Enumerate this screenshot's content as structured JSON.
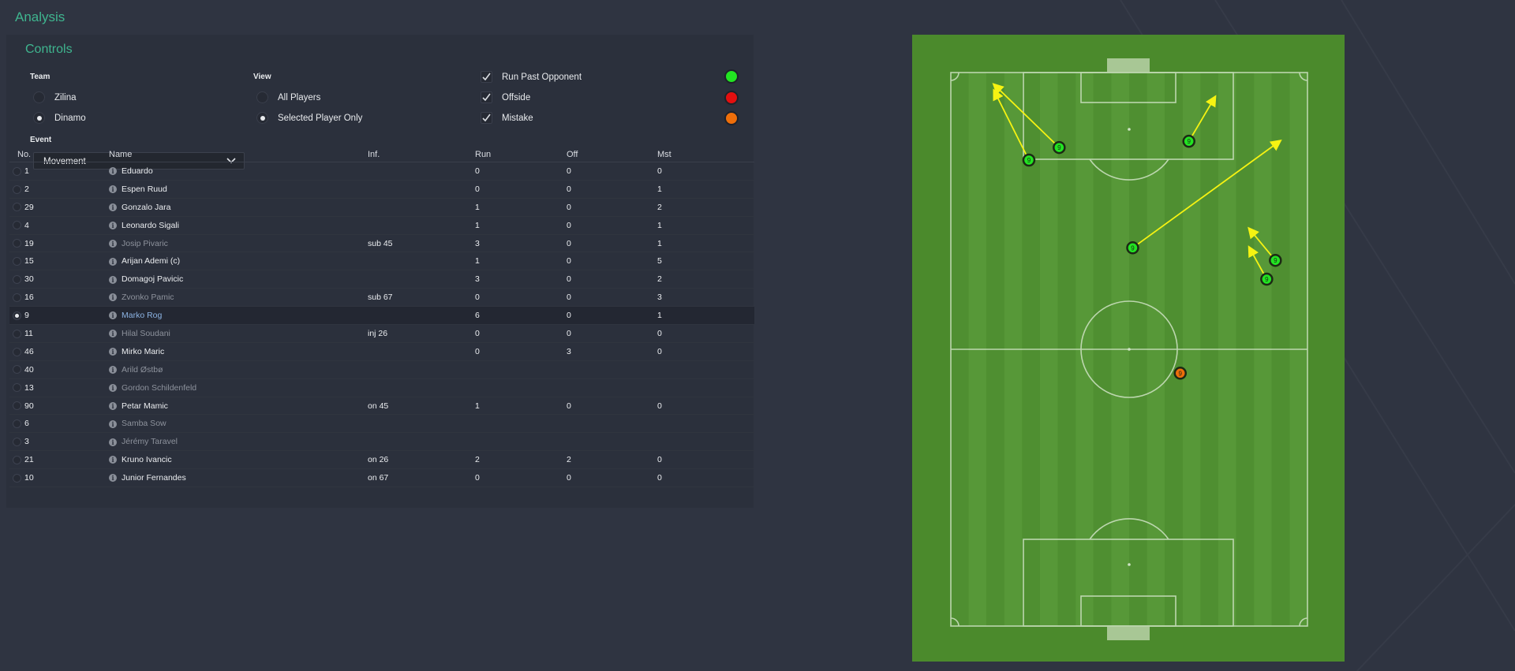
{
  "header": {
    "title": "Analysis"
  },
  "controls": {
    "title": "Controls",
    "team": {
      "label": "Team",
      "options": [
        "Zilina",
        "Dinamo"
      ],
      "selected": "Dinamo"
    },
    "view": {
      "label": "View",
      "options": [
        "All Players",
        "Selected Player Only"
      ],
      "selected": "Selected Player Only"
    },
    "filters": [
      {
        "label": "Run Past Opponent",
        "checked": true,
        "color": "#22e422"
      },
      {
        "label": "Offside",
        "checked": true,
        "color": "#e40f0f"
      },
      {
        "label": "Mistake",
        "checked": true,
        "color": "#ef6e0a"
      }
    ],
    "event": {
      "label": "Event",
      "value": "Movement"
    }
  },
  "table": {
    "headers": {
      "no": "No.",
      "name": "Name",
      "inf": "Inf.",
      "run": "Run",
      "off": "Off",
      "mst": "Mst"
    },
    "rows": [
      {
        "no": "1",
        "name": "Eduardo",
        "inf": "",
        "run": "0",
        "off": "0",
        "mst": "0",
        "dim": false,
        "selected": false
      },
      {
        "no": "2",
        "name": "Espen Ruud",
        "inf": "",
        "run": "0",
        "off": "0",
        "mst": "1",
        "dim": false,
        "selected": false
      },
      {
        "no": "29",
        "name": "Gonzalo Jara",
        "inf": "",
        "run": "1",
        "off": "0",
        "mst": "2",
        "dim": false,
        "selected": false
      },
      {
        "no": "4",
        "name": "Leonardo Sigali",
        "inf": "",
        "run": "1",
        "off": "0",
        "mst": "1",
        "dim": false,
        "selected": false
      },
      {
        "no": "19",
        "name": "Josip Pivaric",
        "inf": "sub 45",
        "run": "3",
        "off": "0",
        "mst": "1",
        "dim": true,
        "selected": false
      },
      {
        "no": "15",
        "name": "Arijan Ademi (c)",
        "inf": "",
        "run": "1",
        "off": "0",
        "mst": "5",
        "dim": false,
        "selected": false
      },
      {
        "no": "30",
        "name": "Domagoj Pavicic",
        "inf": "",
        "run": "3",
        "off": "0",
        "mst": "2",
        "dim": false,
        "selected": false
      },
      {
        "no": "16",
        "name": "Zvonko Pamic",
        "inf": "sub 67",
        "run": "0",
        "off": "0",
        "mst": "3",
        "dim": true,
        "selected": false
      },
      {
        "no": "9",
        "name": "Marko Rog",
        "inf": "",
        "run": "6",
        "off": "0",
        "mst": "1",
        "dim": false,
        "selected": true
      },
      {
        "no": "11",
        "name": "Hilal Soudani",
        "inf": "inj 26",
        "run": "0",
        "off": "0",
        "mst": "0",
        "dim": true,
        "selected": false
      },
      {
        "no": "46",
        "name": "Mirko Maric",
        "inf": "",
        "run": "0",
        "off": "3",
        "mst": "0",
        "dim": false,
        "selected": false
      },
      {
        "no": "40",
        "name": "Arild Østbø",
        "inf": "",
        "run": "",
        "off": "",
        "mst": "",
        "dim": true,
        "selected": false
      },
      {
        "no": "13",
        "name": "Gordon Schildenfeld",
        "inf": "",
        "run": "",
        "off": "",
        "mst": "",
        "dim": true,
        "selected": false
      },
      {
        "no": "90",
        "name": "Petar Mamic",
        "inf": "on 45",
        "run": "1",
        "off": "0",
        "mst": "0",
        "dim": false,
        "selected": false
      },
      {
        "no": "6",
        "name": "Samba Sow",
        "inf": "",
        "run": "",
        "off": "",
        "mst": "",
        "dim": true,
        "selected": false
      },
      {
        "no": "3",
        "name": "Jérémy Taravel",
        "inf": "",
        "run": "",
        "off": "",
        "mst": "",
        "dim": true,
        "selected": false
      },
      {
        "no": "21",
        "name": "Kruno Ivancic",
        "inf": "on 26",
        "run": "2",
        "off": "2",
        "mst": "0",
        "dim": false,
        "selected": false
      },
      {
        "no": "10",
        "name": "Junior Fernandes",
        "inf": "on 67",
        "run": "0",
        "off": "0",
        "mst": "0",
        "dim": false,
        "selected": false
      }
    ]
  },
  "pitch": {
    "events": [
      {
        "type": "run",
        "shirt": "9",
        "from": [
          0.27,
          0.2
        ],
        "to": [
          0.19,
          0.09
        ]
      },
      {
        "type": "run",
        "shirt": "9",
        "from": [
          0.34,
          0.18
        ],
        "to": [
          0.19,
          0.08
        ]
      },
      {
        "type": "run",
        "shirt": "9",
        "from": [
          0.64,
          0.17
        ],
        "to": [
          0.7,
          0.1
        ]
      },
      {
        "type": "run",
        "shirt": "9",
        "from": [
          0.51,
          0.34
        ],
        "to": [
          0.85,
          0.17
        ]
      },
      {
        "type": "run",
        "shirt": "9",
        "from": [
          0.84,
          0.36
        ],
        "to": [
          0.78,
          0.31
        ]
      },
      {
        "type": "run",
        "shirt": "9",
        "from": [
          0.82,
          0.39
        ],
        "to": [
          0.78,
          0.34
        ]
      },
      {
        "type": "mistake",
        "shirt": "9",
        "at": [
          0.62,
          0.54
        ]
      }
    ]
  }
}
